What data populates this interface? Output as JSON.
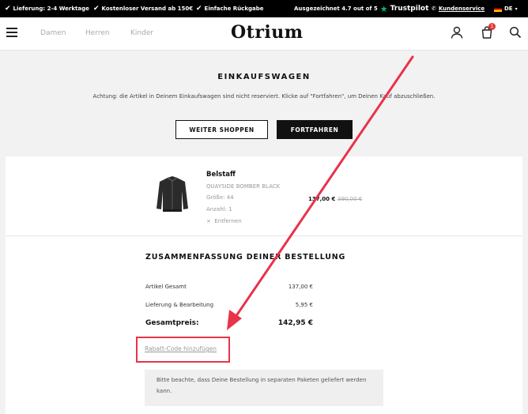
{
  "topbar": {
    "delivery": "Lieferung: 2-4 Werktage",
    "shipping": "Kostenloser Versand ab 150€",
    "returns": "Einfache Rückgabe",
    "rating": "Ausgezeichnet  4.7 out of 5",
    "trustpilot": "Trustpilot",
    "service": "Kundenservice",
    "language": "DE"
  },
  "header": {
    "nav": [
      "Damen",
      "Herren",
      "Kinder"
    ],
    "logo": "Otrium",
    "cart_count": "1"
  },
  "cart": {
    "title": "EINKAUFSWAGEN",
    "notice": "Achtung: die Artikel in Deinem Einkaufswagen sind nicht reserviert. Klicke auf \"Fortfahren\", um Deinen Kauf abzuschließen.",
    "continue_shopping": "WEITER SHOPPEN",
    "proceed": "FORTFAHREN"
  },
  "item": {
    "brand": "Belstaff",
    "name": "QUAYSIDE BOMBER BLACK",
    "size": "Größe: 44",
    "quantity": "Anzahl: 1",
    "remove": "Entfernen",
    "price": "137,00 €",
    "old_price": "390,00 €"
  },
  "summary": {
    "title": "ZUSAMMENFASSUNG DEINER BESTELLUNG",
    "subtotal_label": "Artikel Gesamt",
    "subtotal": "137,00 €",
    "shipping_label": "Lieferung & Bearbeitung",
    "shipping": "5,95 €",
    "total_label": "Gesamtpreis:",
    "total": "142,95 €",
    "discount_link": "Rabatt-Code hinzufügen",
    "info": "Bitte beachte, dass Deine Bestellung in separaten Paketen geliefert werden kann."
  },
  "colors": {
    "highlight": "#e8334a",
    "trustpilot": "#00b67a",
    "badge": "#e53935"
  }
}
